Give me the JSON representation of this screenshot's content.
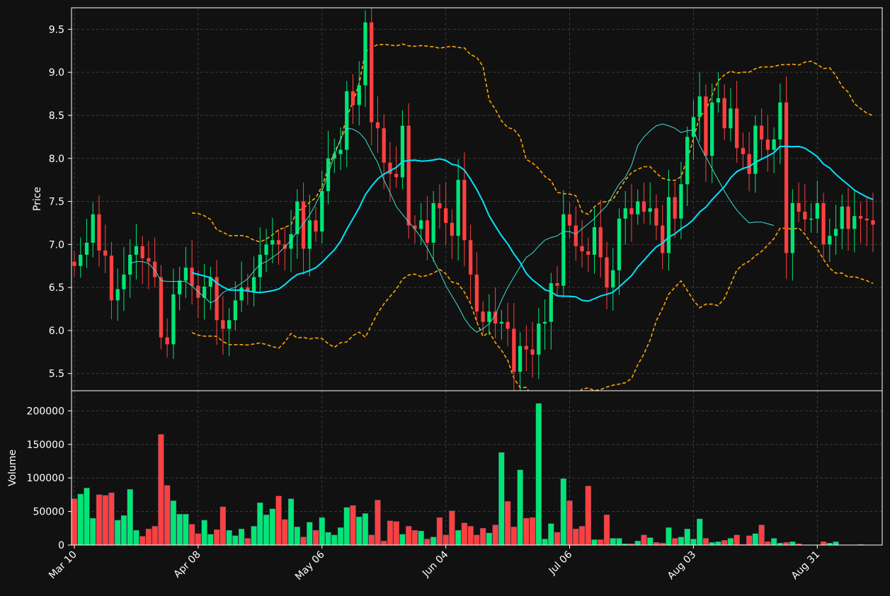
{
  "chart_data": [
    {
      "type": "candlestick",
      "panel": "price",
      "ylabel": "Price",
      "ylim": [
        5.3,
        9.75
      ],
      "yticks": [
        "5.5",
        "6.0",
        "6.5",
        "7.0",
        "7.5",
        "8.0",
        "8.5",
        "9.0",
        "9.5"
      ],
      "xticks": [
        "Mar 10",
        "Apr 08",
        "May 06",
        "Jun 04",
        "Jul 06",
        "Aug 03",
        "Aug 31"
      ],
      "grid": true,
      "colors": {
        "up": "#00e676",
        "down": "#ff4040",
        "ma_short": "#40e0d0",
        "ma_long": "#00e5ff",
        "bands": "#ffa500"
      },
      "close": [
        6.75,
        6.88,
        7.02,
        7.35,
        6.93,
        6.87,
        6.35,
        6.48,
        6.65,
        6.88,
        6.98,
        6.84,
        6.8,
        6.62,
        5.92,
        5.84,
        6.42,
        6.58,
        6.73,
        6.52,
        6.38,
        6.51,
        6.62,
        6.12,
        6.02,
        6.12,
        6.35,
        6.5,
        6.45,
        6.62,
        6.88,
        7.0,
        7.05,
        7.0,
        6.95,
        7.12,
        7.5,
        6.95,
        7.28,
        7.15,
        7.62,
        8.0,
        8.05,
        8.1,
        8.78,
        8.62,
        8.85,
        9.58,
        8.42,
        8.35,
        7.95,
        7.82,
        7.78,
        8.38,
        7.22,
        7.18,
        7.28,
        7.02,
        7.48,
        7.42,
        7.25,
        7.1,
        7.75,
        7.05,
        6.65,
        6.22,
        6.1,
        6.22,
        6.08,
        6.1,
        6.02,
        5.52,
        5.82,
        5.78,
        5.72,
        6.08,
        6.1,
        6.55,
        6.52,
        7.35,
        7.22,
        6.98,
        6.92,
        6.88,
        7.2,
        6.85,
        6.5,
        6.7,
        7.3,
        7.42,
        7.35,
        7.5,
        7.38,
        7.42,
        7.22,
        6.9,
        7.55,
        7.3,
        7.7,
        8.25,
        8.48,
        8.72,
        8.03,
        8.65,
        8.7,
        8.35,
        8.58,
        8.12,
        8.05,
        7.82,
        8.38,
        8.22,
        8.1,
        8.22,
        8.65,
        6.9,
        7.48,
        7.38,
        7.29,
        7.3,
        7.48,
        7.0,
        7.1,
        7.18,
        7.44,
        7.18,
        7.33,
        7.3,
        7.28,
        7.23
      ],
      "ma_short": [
        null,
        null,
        null,
        null,
        null,
        null,
        null,
        null,
        null,
        6.78,
        6.8,
        6.8,
        6.78,
        6.7,
        6.58,
        6.57,
        6.57,
        6.57,
        6.57,
        6.52,
        6.45,
        6.39,
        6.32,
        6.36,
        6.44,
        6.48,
        6.5,
        6.55,
        6.6,
        6.69,
        6.77,
        6.8,
        6.85,
        6.9,
        6.97,
        7.05,
        7.15,
        7.24,
        7.34,
        7.47,
        7.62,
        7.82,
        8.03,
        8.23,
        8.35,
        8.34,
        8.3,
        8.22,
        8.08,
        7.95,
        7.75,
        7.6,
        7.44,
        7.35,
        7.26,
        7.18,
        7.08,
        6.96,
        6.82,
        6.68,
        6.52,
        6.4,
        6.28,
        6.14,
        6.04,
        5.98,
        6.02,
        6.08,
        6.18,
        6.35,
        6.5,
        6.62,
        6.74,
        6.85,
        6.9,
        6.98,
        7.05,
        7.08,
        7.1,
        7.15,
        7.15,
        7.12,
        7.18,
        7.24,
        7.3,
        7.38,
        7.45,
        7.58,
        7.7,
        7.78,
        7.92,
        8.15,
        8.25,
        8.32,
        8.38,
        8.4,
        8.38,
        8.35,
        8.3,
        8.32,
        8.33,
        8.15,
        8.02,
        7.88,
        7.75,
        7.62,
        7.5,
        7.4,
        7.32,
        7.25,
        7.26,
        7.26,
        7.24,
        7.22
      ]
    },
    {
      "type": "bar",
      "panel": "volume",
      "ylabel": "Volume",
      "ylim": [
        0,
        230000
      ],
      "yticks": [
        "0",
        "50000",
        "100000",
        "150000",
        "200000"
      ],
      "values": [
        69000,
        76000,
        85000,
        40000,
        75000,
        74000,
        78000,
        37000,
        44000,
        83000,
        22000,
        13000,
        24000,
        28000,
        165000,
        89000,
        66000,
        46000,
        46000,
        31000,
        17000,
        37000,
        16000,
        23000,
        57000,
        22000,
        14000,
        24000,
        10000,
        28000,
        63000,
        45000,
        54000,
        73000,
        38000,
        69000,
        27000,
        12000,
        34000,
        22000,
        41000,
        19000,
        15000,
        26000,
        56000,
        59000,
        42000,
        47000,
        15000,
        67000,
        6000,
        36000,
        35000,
        16000,
        28000,
        22000,
        21000,
        9000,
        12000,
        41000,
        15000,
        51000,
        22000,
        33000,
        28000,
        15000,
        25000,
        18000,
        30000,
        138000,
        65000,
        27000,
        112000,
        40000,
        41000,
        211000,
        9000,
        32000,
        19000,
        99000,
        66000,
        24000,
        28000,
        88000,
        8000,
        8000,
        45000,
        10000,
        10000,
        2000,
        2000,
        6000,
        15000,
        11000,
        4000,
        3000,
        26000,
        10000,
        12000,
        24000,
        9000,
        39000,
        10000,
        4000,
        5000,
        7000,
        10000,
        15000,
        1000,
        14000,
        17000,
        30000,
        5000,
        10000,
        3000,
        4000,
        5000,
        2000,
        0,
        0,
        0,
        5000,
        3000,
        5000,
        0,
        0,
        0,
        1000
      ]
    }
  ]
}
